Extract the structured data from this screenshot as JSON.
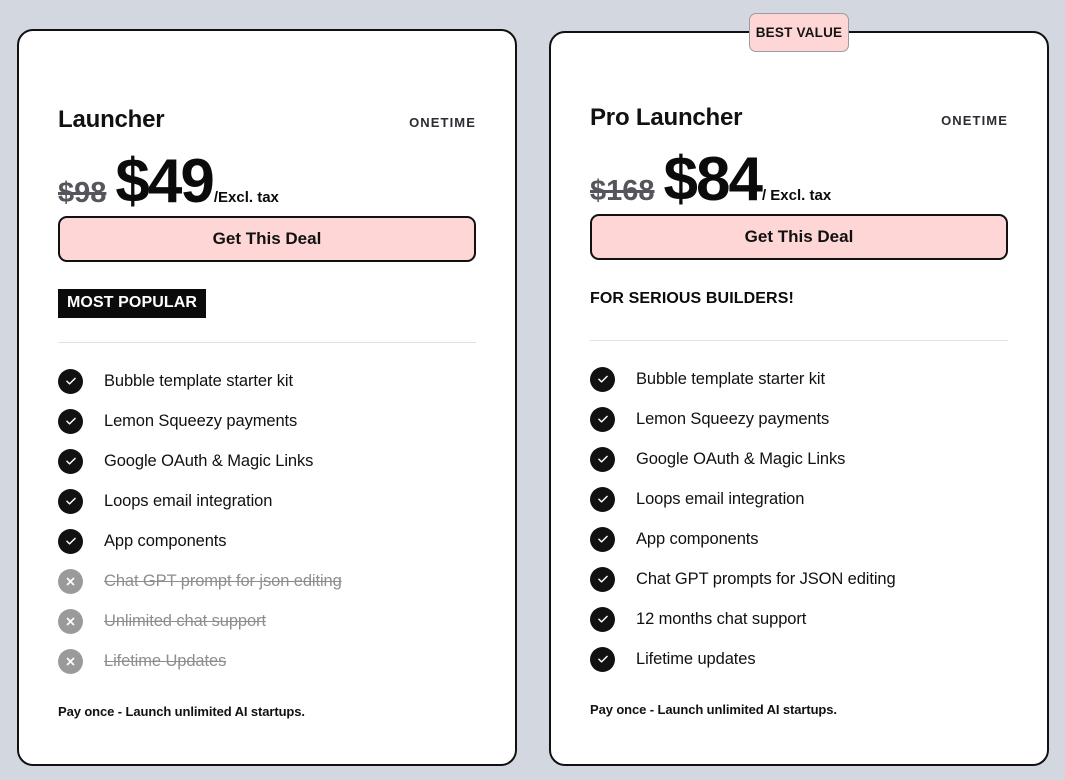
{
  "best_value_badge": "BEST VALUE",
  "plans": [
    {
      "name": "Launcher",
      "term": "ONETIME",
      "old_price": "$98",
      "price": "$49",
      "tax_note": "/Excl. tax",
      "cta": "Get This Deal",
      "tagline": "MOST POPULAR",
      "tagline_style": "dark-badge",
      "features": [
        {
          "label": "Bubble template starter kit",
          "included": true,
          "icon": "check-icon"
        },
        {
          "label": "Lemon Squeezy payments",
          "included": true,
          "icon": "check-icon"
        },
        {
          "label": "Google OAuth & Magic Links",
          "included": true,
          "icon": "check-icon"
        },
        {
          "label": "Loops email integration",
          "included": true,
          "icon": "check-icon"
        },
        {
          "label": "App components",
          "included": true,
          "icon": "check-icon"
        },
        {
          "label": "Chat GPT prompt for json editing",
          "included": false,
          "icon": "cross-icon"
        },
        {
          "label": "Unlimited chat support",
          "included": false,
          "icon": "cross-icon"
        },
        {
          "label": "Lifetime Updates",
          "included": false,
          "icon": "cross-icon"
        }
      ],
      "footer": "Pay once - Launch unlimited AI startups."
    },
    {
      "name": "Pro Launcher",
      "term": "ONETIME",
      "old_price": "$168",
      "price": "$84",
      "tax_note": "/ Excl. tax",
      "cta": "Get This Deal",
      "tagline": "FOR SERIOUS BUILDERS!",
      "tagline_style": "plain",
      "features": [
        {
          "label": "Bubble template starter kit",
          "included": true,
          "icon": "check-icon"
        },
        {
          "label": "Lemon Squeezy payments",
          "included": true,
          "icon": "check-icon"
        },
        {
          "label": "Google OAuth & Magic Links",
          "included": true,
          "icon": "check-icon"
        },
        {
          "label": "Loops email integration",
          "included": true,
          "icon": "check-icon"
        },
        {
          "label": "App components",
          "included": true,
          "icon": "check-icon"
        },
        {
          "label": "Chat GPT prompts for JSON editing",
          "included": true,
          "icon": "check-icon"
        },
        {
          "label": "12 months chat support",
          "included": true,
          "icon": "check-icon"
        },
        {
          "label": "Lifetime updates",
          "included": true,
          "icon": "check-icon"
        }
      ],
      "footer": "Pay once - Launch unlimited AI startups."
    }
  ],
  "colors": {
    "page_background": "#d3d8e0",
    "card_background": "#ffffff",
    "accent_pink": "#ffd6d6",
    "ink": "#111111",
    "muted": "#8e8e92",
    "icon_off": "#9a9a9a"
  }
}
